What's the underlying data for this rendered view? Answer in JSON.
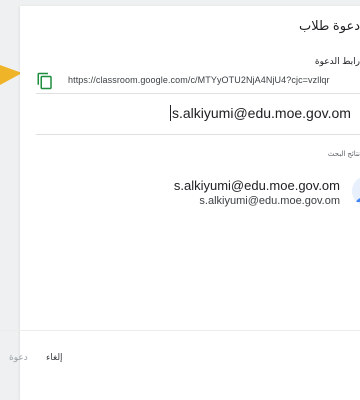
{
  "dialog": {
    "title": "دعوة طلاب",
    "link_label": "رابط الدعوة",
    "link_url": "https://classroom.google.com/c/MTYyOTU2NjA4NjU4?cjc=vzllqr",
    "email_input_value": "s.alkiyumi@edu.moe.gov.om",
    "results_label": "نتائج البحث",
    "result": {
      "name": "s.alkiyumi@edu.moe.gov.om",
      "email": "s.alkiyumi@edu.moe.gov.om"
    },
    "buttons": {
      "cancel": "إلغاء",
      "invite": "دعوة"
    }
  },
  "icons": {
    "copy": "copy-icon",
    "avatar": "default-avatar-icon",
    "callout": "callout-arrow-icon"
  },
  "colors": {
    "highlight": "#f0b429",
    "copy_icon": "#1e8e3e",
    "avatar": "#4285f4"
  }
}
